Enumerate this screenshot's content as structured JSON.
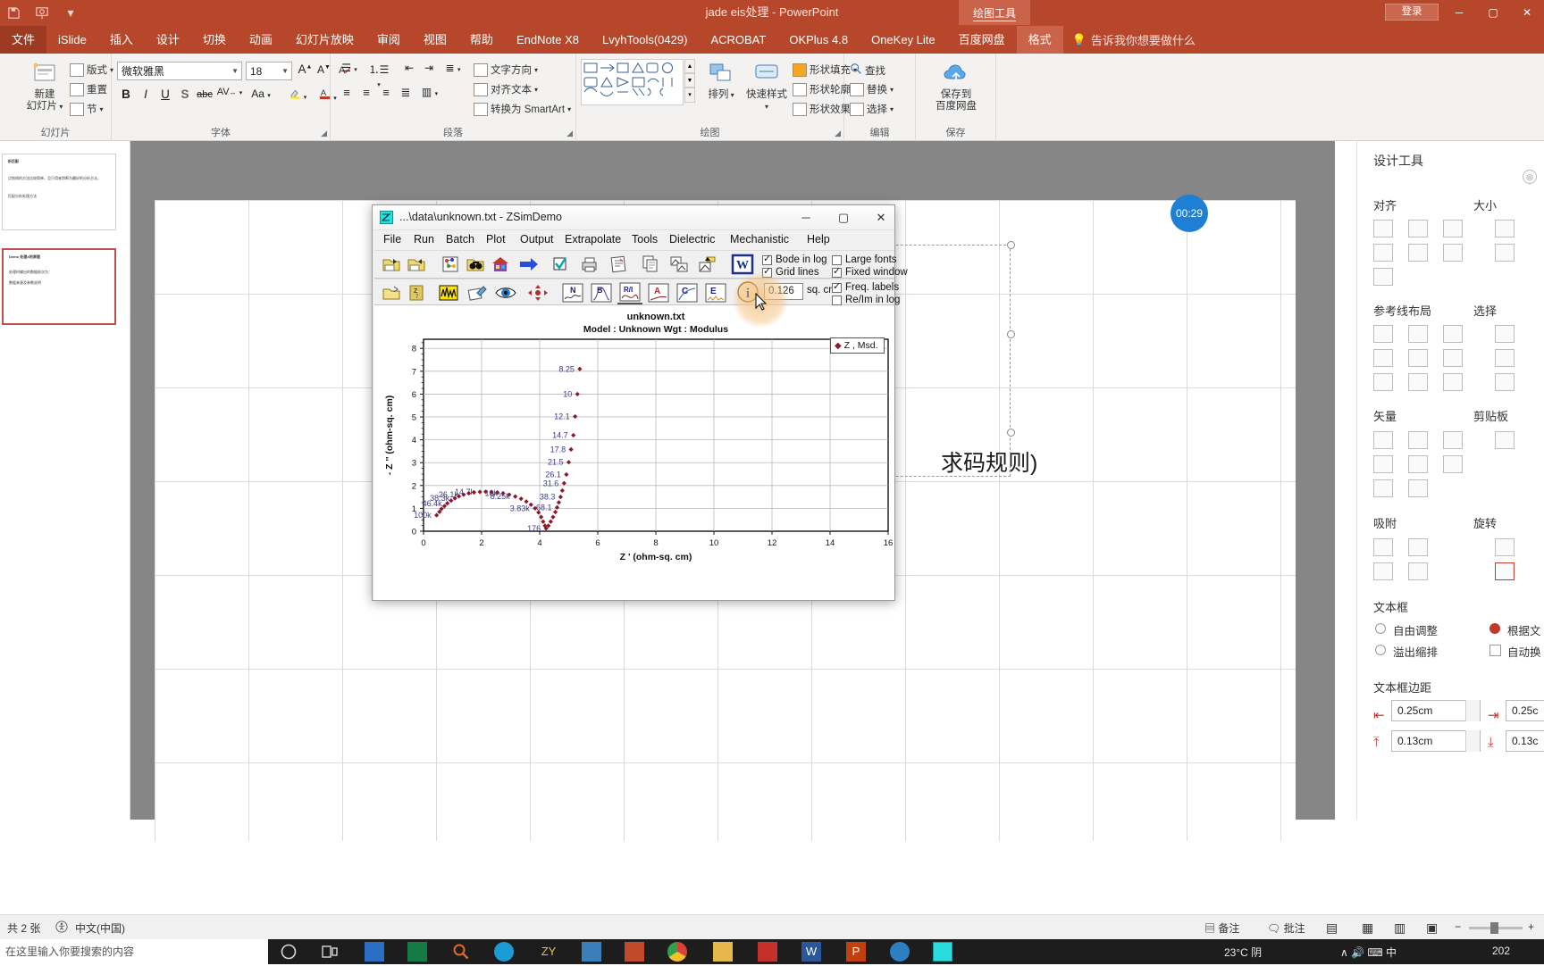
{
  "ppt": {
    "document_title": "jade eis处理  -  PowerPoint",
    "login_label": "登录",
    "contextual_tool": "绘图工具",
    "quick_access": [
      "save-icon",
      "present-icon",
      "customize-qat-icon"
    ],
    "window_buttons": [
      "minimize-icon",
      "maximize-icon",
      "close-icon"
    ],
    "tabs": [
      {
        "label": "文件",
        "kind": "file"
      },
      {
        "label": "iSlide",
        "kind": "normal"
      },
      {
        "label": "插入",
        "kind": "normal"
      },
      {
        "label": "设计",
        "kind": "normal"
      },
      {
        "label": "切换",
        "kind": "normal"
      },
      {
        "label": "动画",
        "kind": "normal"
      },
      {
        "label": "幻灯片放映",
        "kind": "normal"
      },
      {
        "label": "审阅",
        "kind": "normal"
      },
      {
        "label": "视图",
        "kind": "normal"
      },
      {
        "label": "帮助",
        "kind": "normal"
      },
      {
        "label": "EndNote X8",
        "kind": "normal"
      },
      {
        "label": "LvyhTools(0429)",
        "kind": "normal"
      },
      {
        "label": "ACROBAT",
        "kind": "normal"
      },
      {
        "label": "OKPlus 4.8",
        "kind": "normal"
      },
      {
        "label": "OneKey Lite",
        "kind": "normal"
      },
      {
        "label": "百度网盘",
        "kind": "normal"
      },
      {
        "label": "格式",
        "kind": "active"
      }
    ],
    "tell_me": "告诉我你想要做什么",
    "ribbon": {
      "groups": [
        {
          "name": "幻灯片",
          "label": "幻灯片"
        },
        {
          "name": "字体",
          "label": "字体"
        },
        {
          "name": "段落",
          "label": "段落"
        },
        {
          "name": "绘图",
          "label": "绘图"
        },
        {
          "name": "编辑",
          "label": "编辑"
        },
        {
          "name": "保存",
          "label": "保存"
        }
      ],
      "new_slide": "新建\n幻灯片",
      "new_slide_l1": "新建",
      "new_slide_l2": "幻灯片",
      "layout": "版式",
      "reset": "重置",
      "section": "节",
      "font_name": "微软雅黑",
      "font_size": "18",
      "text_direction": "文字方向",
      "align_text": "对齐文本",
      "convert_smartart": "转换为 SmartArt",
      "arrange": "排列",
      "quick_styles": "快速样式",
      "shape_fill": "形状填充",
      "shape_outline": "形状轮廓",
      "shape_effects": "形状效果",
      "find": "查找",
      "replace": "替换",
      "select": "选择",
      "save_to_baidu_l1": "保存到",
      "save_to_baidu_l2": "百度网盘"
    }
  },
  "slide": {
    "text": "求码规则)",
    "timer_badge": "00:29"
  },
  "thumbnails": [
    {
      "index": "1",
      "line1": "析匹配",
      "line2": "点划线的方法比较简单，且只用来判断为最好的分析方法，",
      "line3": "匹配分析处理方法"
    },
    {
      "index": "2",
      "line1": "Demo 处理X的原理",
      "line2": "处理时输出的数据依次为：",
      "line3": "数据来源及参数说明"
    }
  ],
  "right_panel": {
    "title": "设计工具",
    "sections": [
      {
        "label": "对齐"
      },
      {
        "label": "大小"
      },
      {
        "label": "参考线布局"
      },
      {
        "label": "选择"
      },
      {
        "label": "矢量"
      },
      {
        "label": "剪贴板"
      },
      {
        "label": "吸附"
      },
      {
        "label": "旋转"
      },
      {
        "label": "文本框"
      },
      {
        "label": "文本框边距"
      }
    ],
    "textbox_options": [
      {
        "label": "自由调整",
        "type": "radio",
        "checked": false
      },
      {
        "label": "溢出缩排",
        "type": "radio",
        "checked": false
      },
      {
        "label": "根据文",
        "type": "radio-red",
        "checked": true
      },
      {
        "label": "自动换",
        "type": "checkbox",
        "checked": false
      }
    ],
    "margins": [
      {
        "icon": "margin-left-icon",
        "value": "0.25cm"
      },
      {
        "icon": "margin-right-icon",
        "value": "0.25c"
      },
      {
        "icon": "margin-top-icon",
        "value": "0.13cm"
      },
      {
        "icon": "margin-bottom-icon",
        "value": "0.13c"
      }
    ]
  },
  "status_bar": {
    "slide_count": "共 2 张",
    "accessibility": "辅助功能图标",
    "language": "中文(中国)",
    "notes": "备注",
    "comments": "批注",
    "zoom_percent": "",
    "views": [
      "normal-view-icon",
      "sorter-view-icon",
      "reading-view-icon",
      "slideshow-icon"
    ],
    "zoom_minus": "−",
    "zoom_plus": "+"
  },
  "taskbar": {
    "search_placeholder": "在这里输入你要搜索的内容",
    "icons": [
      "cortana-icon",
      "task-view-icon",
      "explorer-icon",
      "origin-icon",
      "search-icon",
      "browser-icon",
      "zy-icon",
      "app-icon",
      "app2-icon",
      "chrome-icon",
      "folder-icon",
      "acrobat-icon",
      "word-icon",
      "powerpoint-icon",
      "skype-icon",
      "zsim-icon"
    ],
    "tray": "23°C  阴",
    "clock_date": "202"
  },
  "zsim": {
    "title": "...\\data\\unknown.txt - ZSimDemo",
    "window_buttons": [
      "minimize-icon",
      "maximize-icon",
      "close-icon"
    ],
    "menu": [
      "File",
      "Run",
      "Batch",
      "Plot",
      "Output",
      "Extrapolate",
      "Tools",
      "Dielectric",
      "Mechanistic",
      "Help"
    ],
    "toolbar_row1": [
      "open-file-icon",
      "save-file-icon",
      "model-icon",
      "browse-icon",
      "home-icon",
      "run-arrow-icon",
      "check-icon",
      "print-icon",
      "report-icon",
      "copy-page-icon",
      "two-plot-icon",
      "export-plot-icon",
      "word-export-icon"
    ],
    "toolbar_row2": [
      "open-folder-icon",
      "zclipboard-icon",
      "noise-icon",
      "edit-data-icon",
      "view-icon",
      "move-icon",
      "nyquist-icon",
      "bode-icon",
      "re-im-icon",
      "admittance-icon",
      "capacitance-icon",
      "epsilon-icon",
      "info-icon"
    ],
    "checkboxes": [
      {
        "label": "Bode in log",
        "checked": true
      },
      {
        "label": "Grid lines",
        "checked": true
      },
      {
        "label": "Large fonts",
        "checked": false
      },
      {
        "label": "Fixed window",
        "checked": true
      },
      {
        "label": "Freq. labels",
        "checked": true
      },
      {
        "label": "Re/Im in log",
        "checked": false
      }
    ],
    "area_value": "0.126",
    "area_unit": "sq. cm",
    "legend": "Z , Msd."
  },
  "chart_data": {
    "type": "scatter",
    "title": "unknown.txt",
    "subtitle": "Model : Unknown    Wgt : Modulus",
    "xlabel": "Z ' (ohm-sq. cm)",
    "ylabel": "- Z '' (ohm-sq. cm)",
    "xlim": [
      0,
      16
    ],
    "ylim": [
      0,
      8.4
    ],
    "xticks": [
      0,
      2,
      4,
      6,
      8,
      10,
      12,
      14,
      16
    ],
    "yticks": [
      0,
      1,
      2,
      3,
      4,
      5,
      6,
      7,
      8
    ],
    "grid": true,
    "legend_position": "top-right-outside",
    "series": [
      {
        "name": "Z , Msd.",
        "color": "#8b1a2b",
        "marker": "diamond",
        "points": [
          {
            "x": 0.45,
            "y": 0.7,
            "label": "100k"
          },
          {
            "x": 0.55,
            "y": 0.85
          },
          {
            "x": 0.62,
            "y": 0.98
          },
          {
            "x": 0.72,
            "y": 1.1
          },
          {
            "x": 0.82,
            "y": 1.22,
            "label": "46.4k"
          },
          {
            "x": 0.95,
            "y": 1.34
          },
          {
            "x": 1.08,
            "y": 1.44,
            "label": "38.3k"
          },
          {
            "x": 1.22,
            "y": 1.53
          },
          {
            "x": 1.38,
            "y": 1.6,
            "label": "26.1k"
          },
          {
            "x": 1.56,
            "y": 1.66
          },
          {
            "x": 1.74,
            "y": 1.7
          },
          {
            "x": 1.94,
            "y": 1.72,
            "label": "14.7k"
          },
          {
            "x": 2.14,
            "y": 1.73
          },
          {
            "x": 2.34,
            "y": 1.72
          },
          {
            "x": 2.54,
            "y": 1.7
          },
          {
            "x": 2.74,
            "y": 1.66,
            "label": "10k"
          },
          {
            "x": 2.95,
            "y": 1.6
          },
          {
            "x": 3.16,
            "y": 1.52,
            "label": "8.25k"
          },
          {
            "x": 3.36,
            "y": 1.42
          },
          {
            "x": 3.54,
            "y": 1.3
          },
          {
            "x": 3.7,
            "y": 1.16
          },
          {
            "x": 3.84,
            "y": 1.0,
            "label": "3.83k"
          },
          {
            "x": 3.96,
            "y": 0.82
          },
          {
            "x": 4.05,
            "y": 0.62
          },
          {
            "x": 4.12,
            "y": 0.42
          },
          {
            "x": 4.18,
            "y": 0.24
          },
          {
            "x": 4.22,
            "y": 0.12,
            "label": "176"
          },
          {
            "x": 4.3,
            "y": 0.24
          },
          {
            "x": 4.38,
            "y": 0.42
          },
          {
            "x": 4.46,
            "y": 0.62
          },
          {
            "x": 4.54,
            "y": 0.84
          },
          {
            "x": 4.6,
            "y": 1.04,
            "label": "68.1"
          },
          {
            "x": 4.66,
            "y": 1.26
          },
          {
            "x": 4.72,
            "y": 1.5,
            "label": "38.3"
          },
          {
            "x": 4.78,
            "y": 1.78
          },
          {
            "x": 4.84,
            "y": 2.1,
            "label": "31.6"
          },
          {
            "x": 4.92,
            "y": 2.48,
            "label": "26.1"
          },
          {
            "x": 5.0,
            "y": 3.02,
            "label": "21.5"
          },
          {
            "x": 5.08,
            "y": 3.58,
            "label": "17.8"
          },
          {
            "x": 5.16,
            "y": 4.2,
            "label": "14.7"
          },
          {
            "x": 5.22,
            "y": 5.02,
            "label": "12.1"
          },
          {
            "x": 5.3,
            "y": 6.0,
            "label": "10"
          },
          {
            "x": 5.38,
            "y": 7.1,
            "label": "8.25"
          }
        ]
      }
    ]
  }
}
